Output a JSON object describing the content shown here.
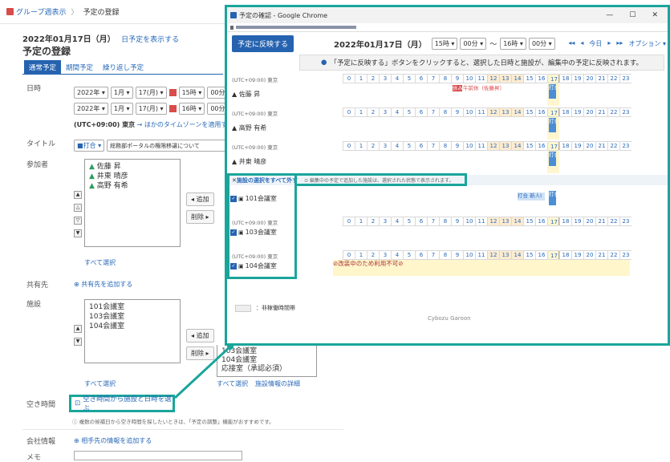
{
  "breadcrumb": {
    "group_view": "グループ週表示",
    "separator": "〉",
    "current": "予定の登録"
  },
  "header": {
    "date": "2022年01月17日（月）",
    "show_schedule_link": "日予定を表示する",
    "page_title": "予定の登録"
  },
  "tabs": [
    {
      "label": "通常予定"
    },
    {
      "label": "期間予定"
    },
    {
      "label": "繰り返し予定"
    }
  ],
  "form": {
    "datetime_label": "日時",
    "start": {
      "year": "2022年 ▾",
      "month": "1月 ▾",
      "day": "17(月) ▾",
      "hour": "15時 ▾",
      "minute": "00分 ▾"
    },
    "end": {
      "year": "2022年 ▾",
      "month": "1月 ▾",
      "day": "17(月) ▾",
      "hour": "16時 ▾",
      "minute": "00分 ▾"
    },
    "timezone_text": "(UTC+09:00) 東京",
    "timezone_link": "→ ほかのタイムゾーンを適用する",
    "title_label": "タイトル",
    "title_category": "■打合 ▾",
    "title_value": "総務部ポータルの権限移譲について",
    "participants_label": "参加者",
    "participants": [
      "佐藤 昇",
      "井東 晴彦",
      "高野 有希"
    ],
    "add_button": "◂ 追加",
    "remove_button": "削除 ▸",
    "select_all": "すべて選択",
    "share_label": "共有先",
    "share_link": "共有先を追加する",
    "facility_label": "施設",
    "facilities": [
      "101会議室",
      "103会議室",
      "104会議室"
    ],
    "facility_candidates": [
      "103会議室",
      "104会議室",
      "応接室（承認必須）"
    ],
    "facility_select_all": "すべて選択",
    "facility_detail_link": "施設情報の詳細",
    "free_time_label": "空き時間",
    "free_time_button": "空き時間から施設と日時を選ぶ",
    "free_time_hint": "複数の候補日から空き時間を探したいときは、「予定の調整」機能がおすすめです。",
    "hint_link": "「予定の調整」",
    "company_label": "会社情報",
    "company_link": "相手先の情報を追加する",
    "memo_label": "メモ"
  },
  "popup": {
    "window_title": "予定の確認 - Google Chrome",
    "minimize": "—",
    "maximize": "☐",
    "close": "✕",
    "reflect_button": "予定に反映する",
    "date": "2022年01月17日（月）",
    "start_hour": "15時 ▾",
    "start_min": "00分 ▾",
    "tilde": "〜",
    "end_hour": "16時 ▾",
    "end_min": "00分 ▾",
    "nav_prev_week": "◂◂",
    "nav_prev": "◂",
    "nav_today": "今日",
    "nav_next": "▸",
    "nav_next_week": "▸▸",
    "options": "オプション ▾",
    "info_text": "「予定に反映する」ボタンをクリックすると、選択した日時と施設が、編集中の予定に反映されます。",
    "hours": [
      "0",
      "1",
      "2",
      "3",
      "4",
      "5",
      "6",
      "7",
      "8",
      "9",
      "10",
      "11",
      "12",
      "13",
      "14",
      "15",
      "16",
      "17",
      "18",
      "19",
      "20",
      "21",
      "22",
      "23"
    ],
    "tz_label": "(UTC+09:00) 東京",
    "people": [
      {
        "name": "佐藤 昇",
        "events": [
          {
            "label": "休み",
            "label2": "午前休（佐藤昇）"
          },
          {
            "label": "打合"
          }
        ]
      },
      {
        "name": "高野 有希",
        "events": [
          {
            "label": "打合"
          }
        ]
      },
      {
        "name": "井東 晴彦",
        "events": [
          {
            "label": "打合"
          }
        ]
      }
    ],
    "remove_all_facilities": "施設の選択をすべて外す",
    "facility_note": "編集中の予定で追加した施設は、選択された状態で表示されます。",
    "facility_rows": [
      {
        "name": "101会議室",
        "events": [
          {
            "label": "打合 新人I"
          },
          {
            "label": "打合"
          }
        ]
      },
      {
        "name": "103会議室",
        "events": []
      },
      {
        "name": "104会議室",
        "events": [
          {
            "label": "改装中のため利用不可"
          }
        ]
      }
    ],
    "legend_text": "：非稼働時間帯",
    "footer": "Cybozu Garoon"
  },
  "colors": {
    "accent_teal": "#1aa59b",
    "brand_blue": "#2563b0",
    "link_blue": "#2a6ab8"
  }
}
